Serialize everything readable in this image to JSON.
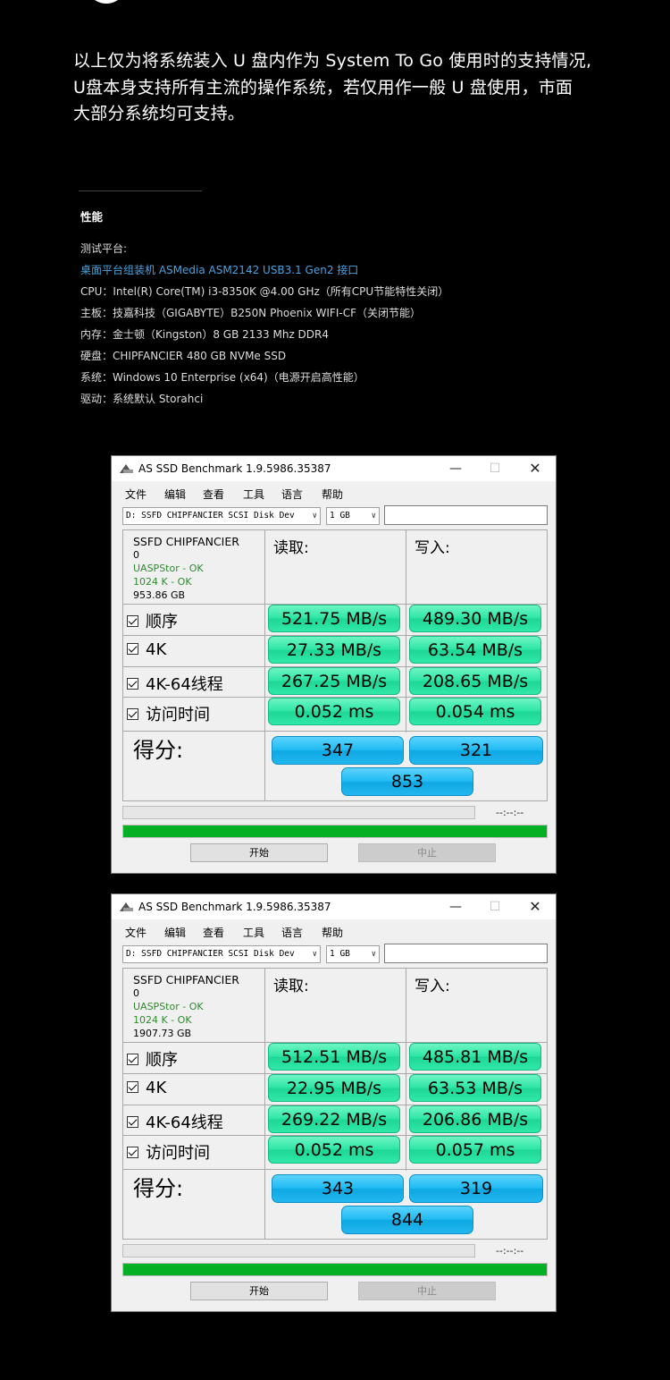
{
  "intro": {
    "lines": [
      "以上仅为将系统装入 U 盘内作为 System To Go 使用时的支持情况,",
      "U盘本身支持所有主流的操作系统，若仅用作一般 U 盘使用，市面",
      "大部分系统均可支持。"
    ]
  },
  "spec": {
    "title": "性能",
    "lines": [
      "测试平台:",
      "桌面平台组装机 ASMedia ASM2142 USB3.1 Gen2 接口",
      "CPU：Intel(R) Core(TM) i3-8350K @4.00 GHz（所有CPU节能特性关闭）",
      "主板：技嘉科技（GIGABYTE）B250N Phoenix WIFI-CF（关闭节能）",
      "内存：金士顿（Kingston）8 GB 2133 Mhz DDR4",
      "硬盘：CHIPFANCIER 480 GB NVMe SSD",
      "系统：Windows 10 Enterprise (x64)（电源开启高性能）",
      "驱动：系统默认 Storahci"
    ],
    "highlight_color": "#4aa3e0"
  },
  "windows": [
    {
      "title": "AS SSD Benchmark 1.9.5986.35387",
      "controls": {
        "minimize": "—",
        "maximize": "☐",
        "close": "✕"
      },
      "menu": [
        "文件",
        "编辑",
        "查看",
        "工具",
        "语言",
        "帮助"
      ],
      "disk_select": "D: SSFD CHIPFANCIER SCSI Disk Dev",
      "size_select": "1 GB",
      "info": {
        "model": "SSFD CHIPFANCIER",
        "zero": "0",
        "driver": "UASPStor - OK",
        "align": "1024 K - OK",
        "capacity": "953.86 GB"
      },
      "read_header": "读取:",
      "write_header": "写入:",
      "rows": [
        {
          "label": "顺序",
          "read": "521.75 MB/s",
          "write": "489.30 MB/s"
        },
        {
          "label": "4K",
          "read": "27.33 MB/s",
          "write": "63.54 MB/s"
        },
        {
          "label": "4K-64线程",
          "read": "267.25 MB/s",
          "write": "208.65 MB/s"
        },
        {
          "label": "访问时间",
          "read": "0.052 ms",
          "write": "0.054 ms"
        }
      ],
      "score_label": "得分:",
      "score_read": "347",
      "score_write": "321",
      "score_total": "853",
      "timer": "--:--:--",
      "progress": 1.0,
      "start": "开始",
      "stop": "中止"
    },
    {
      "title": "AS SSD Benchmark 1.9.5986.35387",
      "controls": {
        "minimize": "—",
        "maximize": "☐",
        "close": "✕"
      },
      "menu": [
        "文件",
        "编辑",
        "查看",
        "工具",
        "语言",
        "帮助"
      ],
      "disk_select": "D: SSFD CHIPFANCIER SCSI Disk Dev",
      "size_select": "1 GB",
      "info": {
        "model": "SSFD CHIPFANCIER",
        "zero": "0",
        "driver": "UASPStor - OK",
        "align": "1024 K - OK",
        "capacity": "1907.73 GB"
      },
      "read_header": "读取:",
      "write_header": "写入:",
      "rows": [
        {
          "label": "顺序",
          "read": "512.51 MB/s",
          "write": "485.81 MB/s"
        },
        {
          "label": "4K",
          "read": "22.95 MB/s",
          "write": "63.53 MB/s"
        },
        {
          "label": "4K-64线程",
          "read": "269.22 MB/s",
          "write": "206.86 MB/s"
        },
        {
          "label": "访问时间",
          "read": "0.052 ms",
          "write": "0.057 ms"
        }
      ],
      "score_label": "得分:",
      "score_read": "343",
      "score_write": "319",
      "score_total": "844",
      "timer": "--:--:--",
      "progress": 1.0,
      "start": "开始",
      "stop": "中止"
    }
  ]
}
